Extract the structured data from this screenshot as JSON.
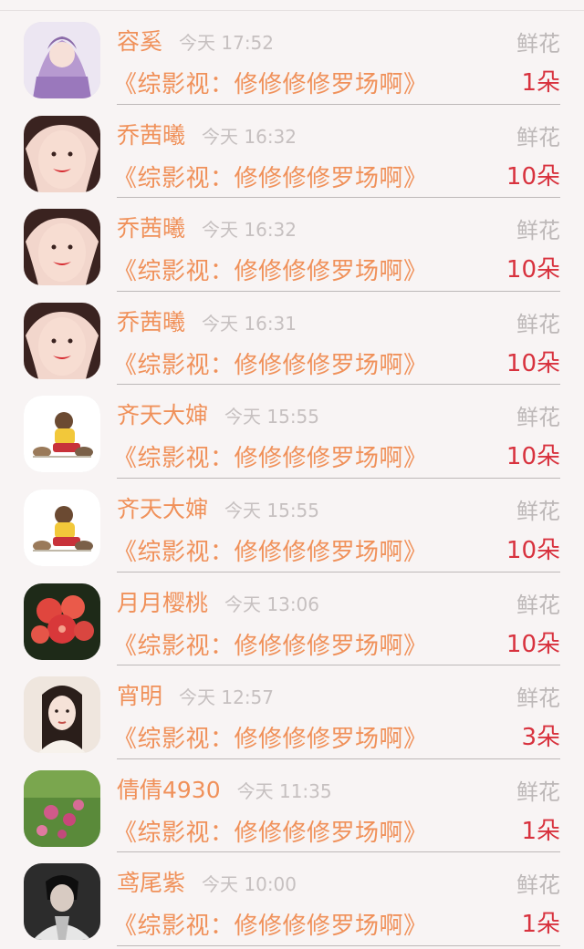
{
  "gift_rows": [
    {
      "name": "容奚",
      "time": "今天 17:52",
      "gift": "鲜花",
      "title": "《综影视：修修修修罗场啊》",
      "count": "1朵",
      "avatar": "girl-purple"
    },
    {
      "name": "乔茜曦",
      "time": "今天 16:32",
      "gift": "鲜花",
      "title": "《综影视：修修修修罗场啊》",
      "count": "10朵",
      "avatar": "smiling-woman"
    },
    {
      "name": "乔茜曦",
      "time": "今天 16:32",
      "gift": "鲜花",
      "title": "《综影视：修修修修罗场啊》",
      "count": "10朵",
      "avatar": "smiling-woman"
    },
    {
      "name": "乔茜曦",
      "time": "今天 16:31",
      "gift": "鲜花",
      "title": "《综影视：修修修修罗场啊》",
      "count": "10朵",
      "avatar": "smiling-woman"
    },
    {
      "name": "齐天大婶",
      "time": "今天 15:55",
      "gift": "鲜花",
      "title": "《综影视：修修修修罗场啊》",
      "count": "10朵",
      "avatar": "kid-with-dogs"
    },
    {
      "name": "齐天大婶",
      "time": "今天 15:55",
      "gift": "鲜花",
      "title": "《综影视：修修修修罗场啊》",
      "count": "10朵",
      "avatar": "kid-with-dogs"
    },
    {
      "name": "月月樱桃",
      "time": "今天 13:06",
      "gift": "鲜花",
      "title": "《综影视：修修修修罗场啊》",
      "count": "10朵",
      "avatar": "red-flowers"
    },
    {
      "name": "宵明",
      "time": "今天 12:57",
      "gift": "鲜花",
      "title": "《综影视：修修修修罗场啊》",
      "count": "3朵",
      "avatar": "costume-man"
    },
    {
      "name": "倩倩4930",
      "time": "今天 11:35",
      "gift": "鲜花",
      "title": "《综影视：修修修修罗场啊》",
      "count": "1朵",
      "avatar": "garden-flowers"
    },
    {
      "name": "鸢尾紫",
      "time": "今天 10:00",
      "gift": "鲜花",
      "title": "《综影视：修修修修罗场啊》",
      "count": "1朵",
      "avatar": "dark-portrait"
    }
  ]
}
